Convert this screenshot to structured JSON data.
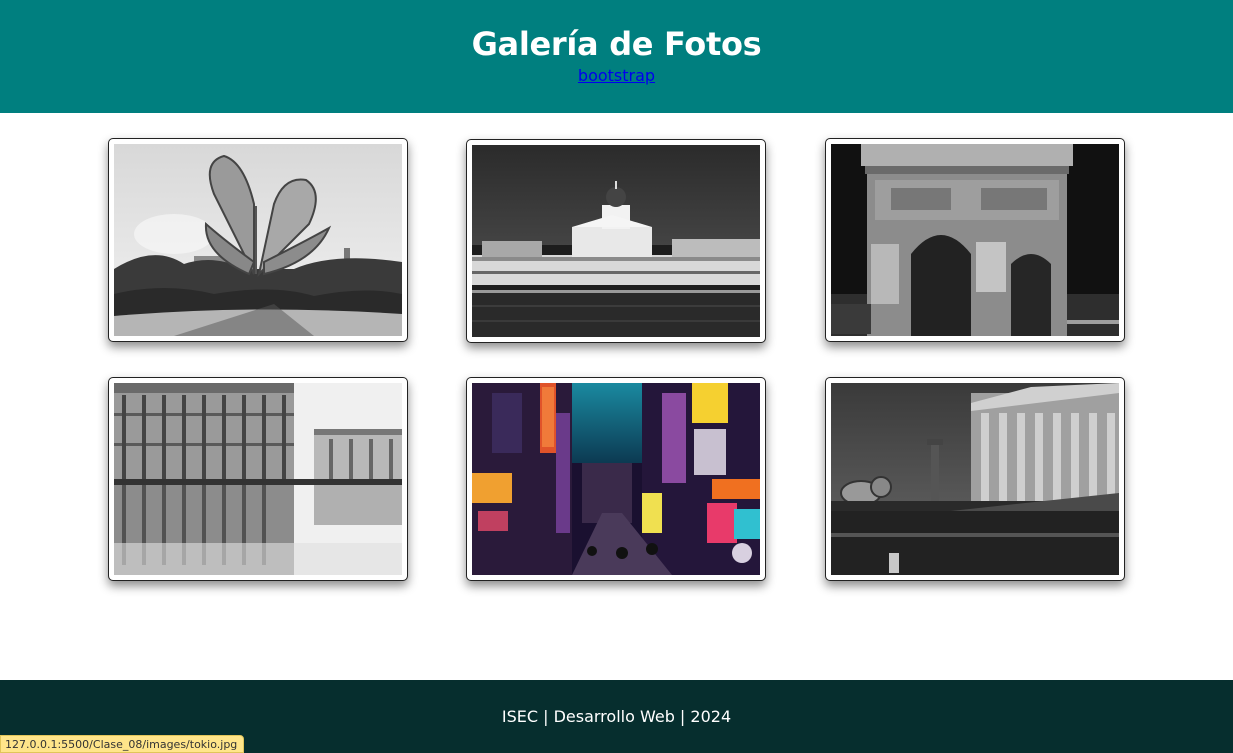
{
  "header": {
    "title": "Galería de Fotos",
    "link_label": "bootstrap",
    "background": "#007f7f"
  },
  "gallery": {
    "images": [
      {
        "name": "floralis",
        "style": "grayscale"
      },
      {
        "name": "helsinki",
        "style": "grayscale"
      },
      {
        "name": "arco-triunfo",
        "style": "grayscale"
      },
      {
        "name": "hermitage",
        "style": "grayscale"
      },
      {
        "name": "tokio",
        "style": "color"
      },
      {
        "name": "buenos-aires",
        "style": "grayscale"
      }
    ]
  },
  "footer": {
    "text": "ISEC | Desarrollo Web | 2024",
    "background": "#062e2e"
  },
  "status_bar": {
    "url": "127.0.0.1:5500/Clase_08/images/tokio.jpg"
  }
}
